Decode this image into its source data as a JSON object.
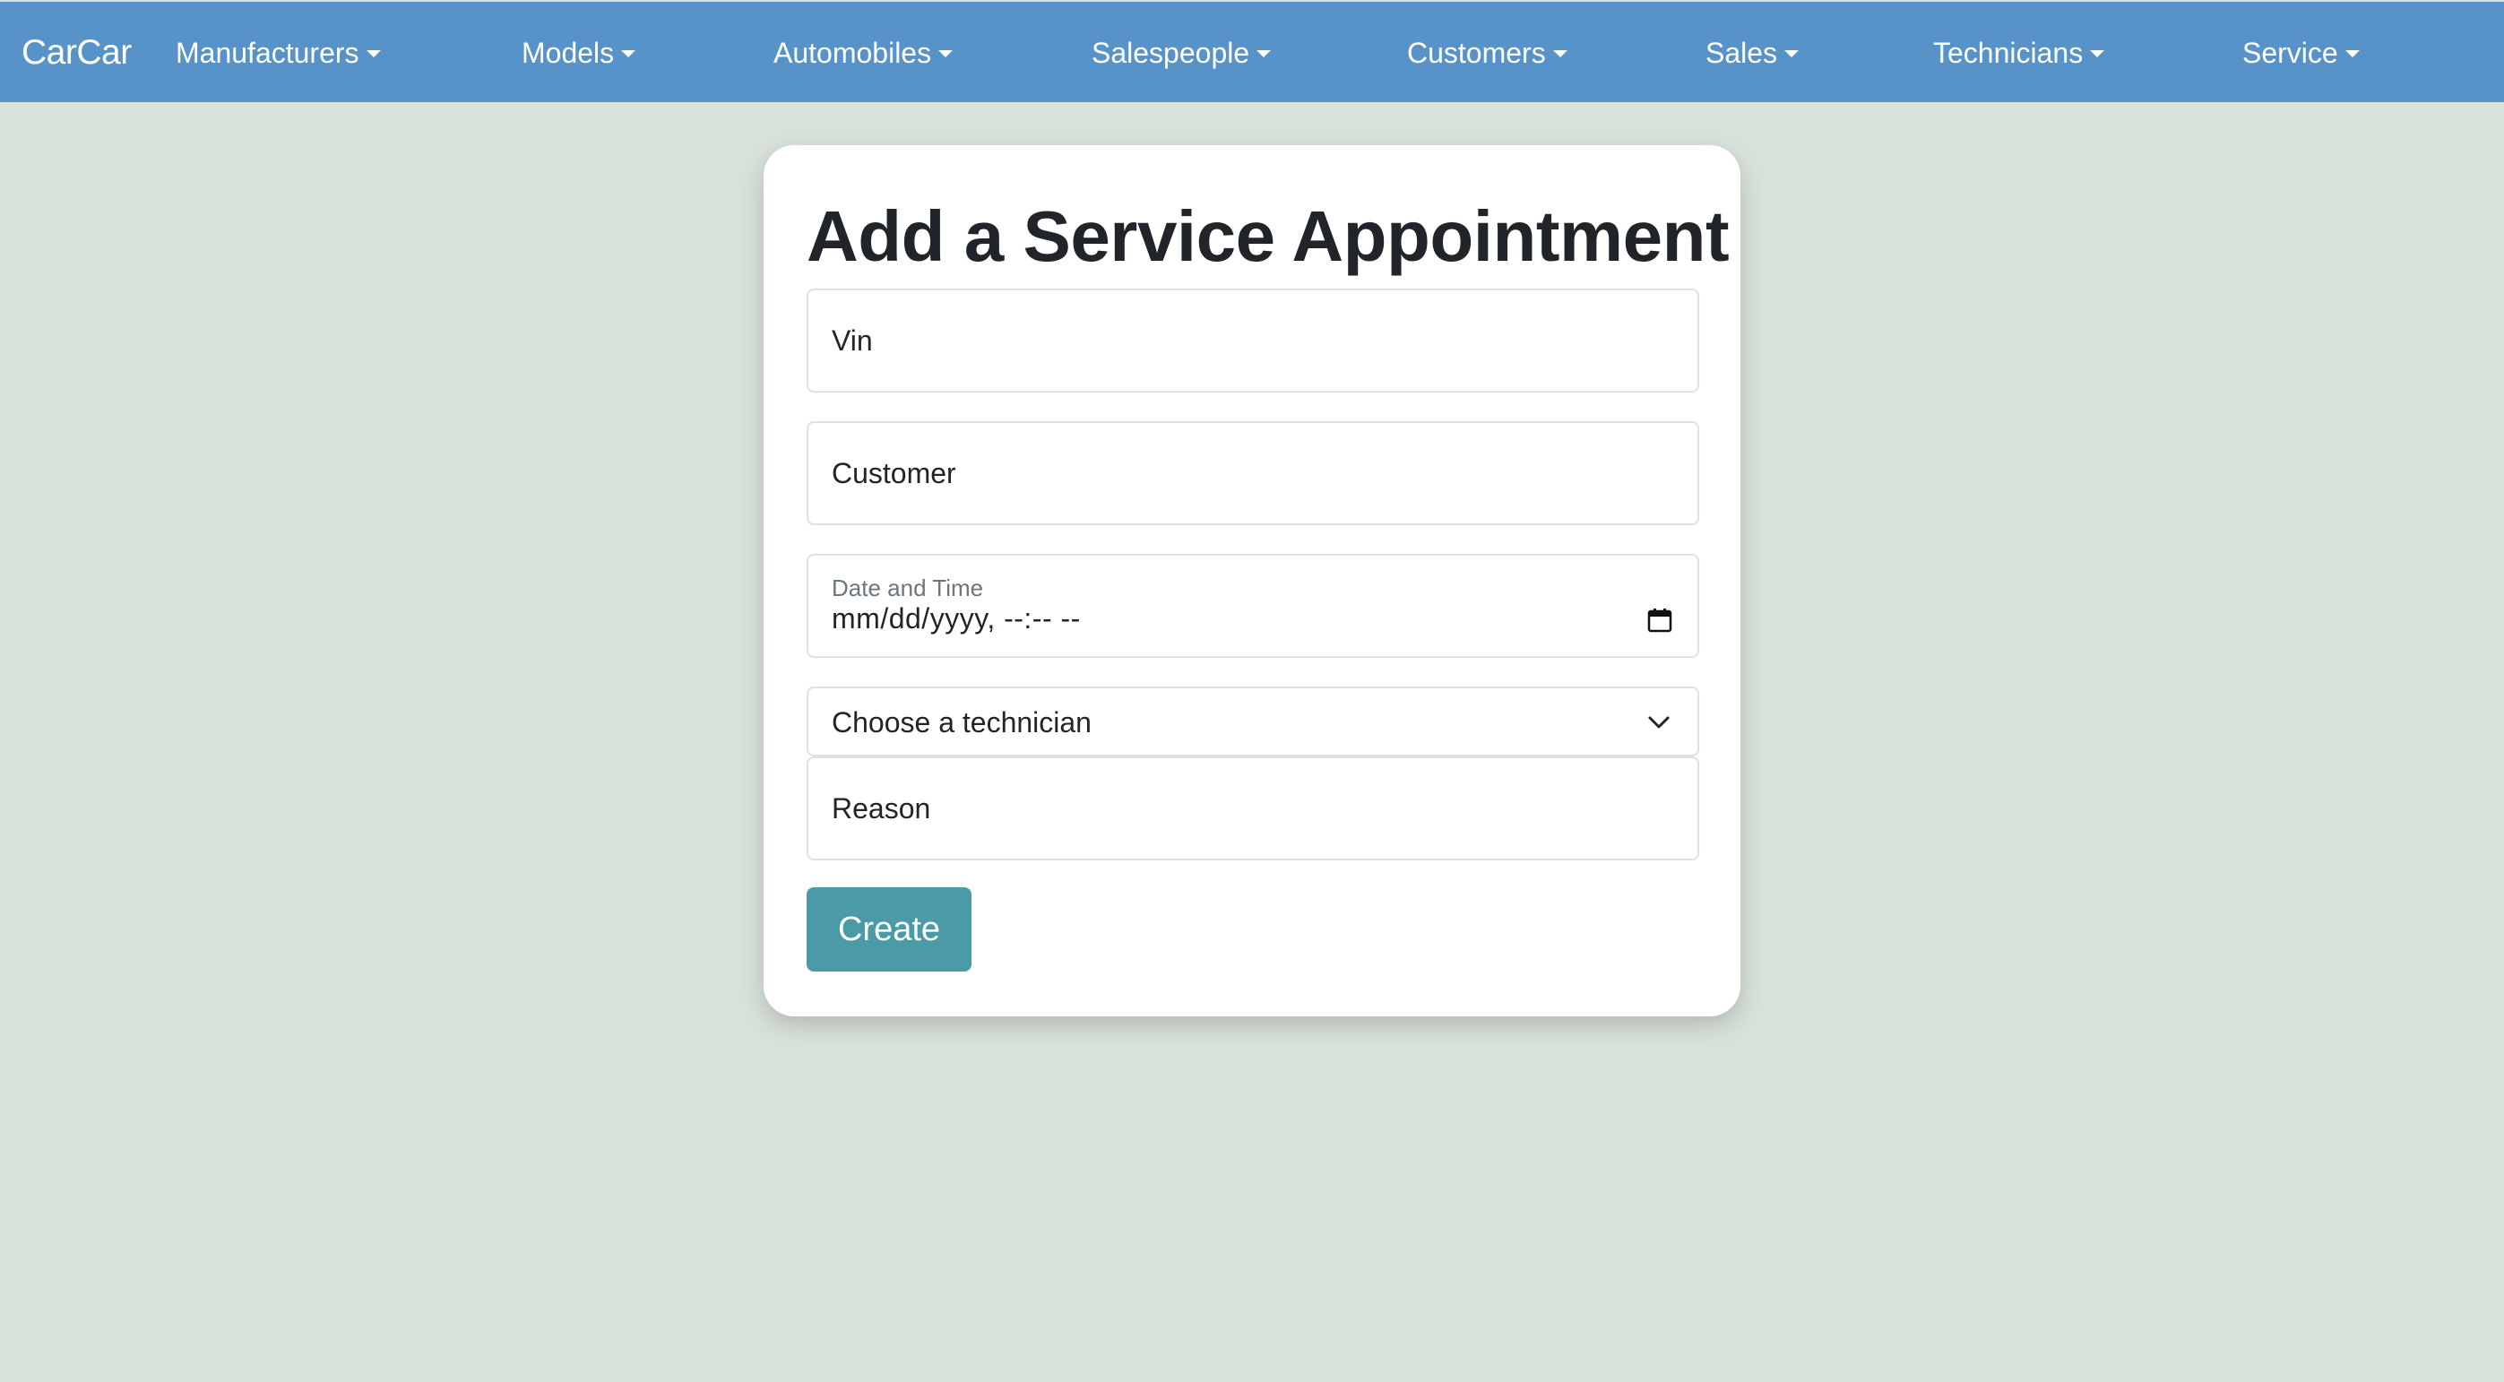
{
  "navbar": {
    "brand": "CarCar",
    "items": [
      {
        "label": "Manufacturers"
      },
      {
        "label": "Models"
      },
      {
        "label": "Automobiles"
      },
      {
        "label": "Salespeople"
      },
      {
        "label": "Customers"
      },
      {
        "label": "Sales"
      },
      {
        "label": "Technicians"
      },
      {
        "label": "Service"
      }
    ]
  },
  "form": {
    "title": "Add a Service Appointment",
    "vin_placeholder": "Vin",
    "customer_placeholder": "Customer",
    "datetime_label": "Date and Time",
    "datetime_value": "mm/dd/yyyy, --:-- --",
    "technician_select": "Choose a technician",
    "reason_placeholder": "Reason",
    "submit_label": "Create"
  },
  "colors": {
    "navbar_bg": "#5793c9",
    "page_bg": "#d9e2da",
    "button_bg": "#4b9aa8"
  },
  "icons": {
    "calendar": "calendar-icon",
    "select_chevron": "chevron-down-icon",
    "nav_caret": "caret-down-icon"
  }
}
